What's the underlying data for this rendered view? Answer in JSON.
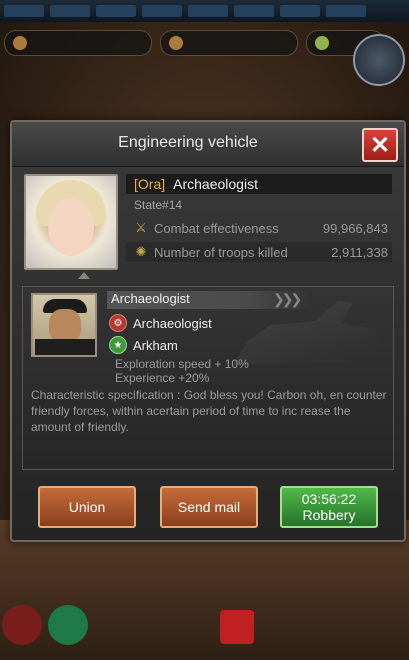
{
  "dialog": {
    "title": "Engineering vehicle",
    "close_label": "✕"
  },
  "profile": {
    "alliance_tag": "[Ora]",
    "name": "Archaeologist",
    "state": "State#14",
    "stats": [
      {
        "label": "Combat effectiveness",
        "value": "99,966,843",
        "icon": "crossed-swords-icon"
      },
      {
        "label": "Number of troops killed",
        "value": "2,911,338",
        "icon": "claw-icon"
      }
    ]
  },
  "officer": {
    "role": "Archaeologist",
    "skills": [
      {
        "name": "Archaeologist",
        "icon": "skill-red-icon"
      },
      {
        "name": "Arkham",
        "icon": "star-green-icon"
      }
    ],
    "bonuses": [
      "Exploration speed + 10%",
      "Experience +20%"
    ],
    "description": "Characteristic specification : God bless you! Carbon oh, en counter friendly forces, within acertain period of time to inc rease the amount of friendly."
  },
  "actions": {
    "union": "Union",
    "send_mail": "Send mail",
    "robbery_timer": "03:56:22",
    "robbery": "Robbery"
  },
  "colors": {
    "close": "#c2302a",
    "brown_button": "#a9542a",
    "green_button": "#3c9a3a",
    "alliance_tag": "#e6b24a"
  }
}
